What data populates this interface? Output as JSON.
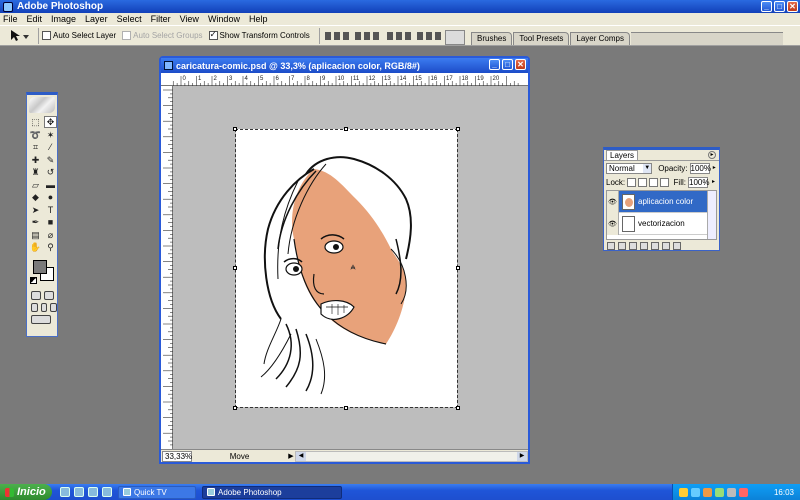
{
  "app": {
    "title": "Adobe Photoshop"
  },
  "menu": [
    "File",
    "Edit",
    "Image",
    "Layer",
    "Select",
    "Filter",
    "View",
    "Window",
    "Help"
  ],
  "options": {
    "auto_select_layer": "Auto Select Layer",
    "auto_select_groups": "Auto Select Groups",
    "show_transform_controls": "Show Transform Controls",
    "auto_select_layer_checked": false,
    "auto_select_groups_checked": false,
    "show_transform_controls_checked": true
  },
  "palette_well": {
    "tabs": [
      "Brushes",
      "Tool Presets",
      "Layer Comps"
    ]
  },
  "document": {
    "title": "caricatura-comic.psd @ 33,3% (aplicacion color, RGB/8#)",
    "zoom": "33,33%",
    "status": "Move",
    "ruler_top": [
      "1",
      "0",
      "1",
      "2",
      "3",
      "4",
      "5",
      "6",
      "7",
      "8",
      "9",
      "10",
      "11",
      "12",
      "13",
      "14",
      "15",
      "16",
      "17",
      "18",
      "19",
      "20"
    ]
  },
  "layers": {
    "tab": "Layers",
    "blend_mode": "Normal",
    "opacity_label": "Opacity:",
    "opacity": "100%",
    "lock_label": "Lock:",
    "fill_label": "Fill:",
    "fill": "100%",
    "items": [
      {
        "name": "aplicacion color",
        "active": true
      },
      {
        "name": "vectorizacion",
        "active": false
      }
    ]
  },
  "taskbar": {
    "start": "Inicio",
    "tasks": [
      "Quick TV",
      "Adobe Photoshop"
    ],
    "clock": "16:03"
  },
  "colors": {
    "skin": "#e8a27a",
    "xp_blue": "#2a5ad8",
    "selection": "#3169c6"
  }
}
